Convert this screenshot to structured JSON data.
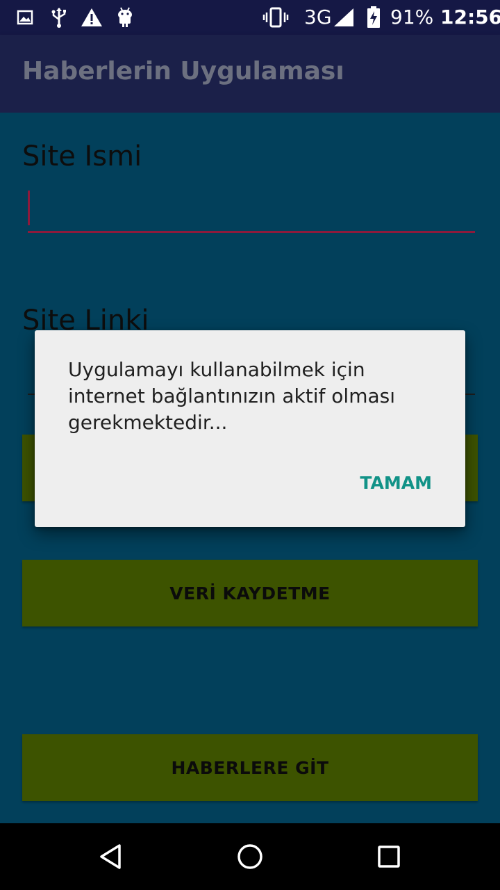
{
  "status_bar": {
    "network": "3G",
    "battery": "91%",
    "time": "12:56",
    "icons": [
      "image-icon",
      "usb-icon",
      "warning-icon",
      "android-icon",
      "vibrate-icon",
      "signal-icon",
      "battery-charging-icon"
    ]
  },
  "app_bar": {
    "title": "Haberlerin Uygulaması"
  },
  "form": {
    "site_name_label": "Site Ismi",
    "site_name_value": "",
    "site_link_label": "Site Linki",
    "site_link_value": ""
  },
  "buttons": {
    "save_label": "VERİ KAYDETME",
    "news_label": "HABERLERE GİT"
  },
  "dialog": {
    "message": "Uygulamayı kullanabilmek için internet bağlantınızın aktif olması gerekmektedir...",
    "ok_label": "TAMAM"
  },
  "nav_bar": {
    "icons": [
      "back-icon",
      "home-icon",
      "recents-icon"
    ]
  },
  "colors": {
    "background": "#02405b",
    "app_bar": "#1b2049",
    "status_bar": "#151845",
    "button": "#3d5300",
    "accent": "#119287",
    "input_focus": "#8d1a3c"
  }
}
